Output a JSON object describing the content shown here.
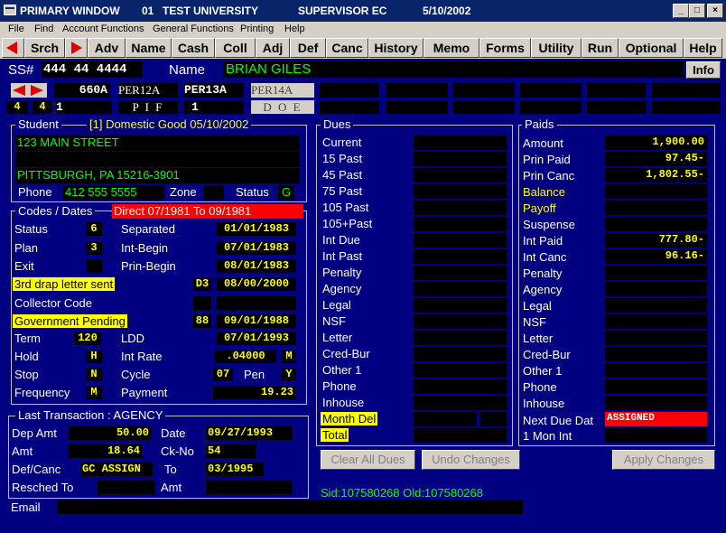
{
  "title_bar": {
    "window": "PRIMARY WINDOW",
    "code": "01",
    "institution": "TEST UNIVERSITY",
    "role": "SUPERVISOR  EC",
    "date": "5/10/2002",
    "minimize": "_",
    "maximize": "□",
    "close": "×"
  },
  "menu": [
    "File",
    "Find",
    "Account Functions",
    "General Functions",
    "Printing",
    "Help"
  ],
  "toolbar": [
    "Srch",
    "Adv",
    "Name",
    "Cash",
    "Coll",
    "Adj",
    "Def",
    "Canc",
    "History",
    "Memo",
    "Forms",
    "Utility",
    "Run",
    "Optional",
    "Help"
  ],
  "ssn_row": {
    "ss_label": "SS#",
    "ss_value": "444 44 4444",
    "name_label": "Name",
    "name_value": "BRIAN GILES",
    "info_button": "Info"
  },
  "period_row": {
    "top": [
      "660A",
      "PER12A",
      "PER13A",
      "PER14A"
    ],
    "bottom": [
      "P I F",
      "1",
      "D O E"
    ],
    "small": [
      "4",
      "4"
    ],
    "one": "1"
  },
  "student": {
    "header": "Student",
    "status_header": "[1] Domestic Good  05/10/2002",
    "address1": "123 MAIN STREET",
    "address2": "",
    "address3": "",
    "city": "PITTSBURGH, PA 15216-3901",
    "phone_label": "Phone",
    "phone": "412 555 5555",
    "zone_label": "Zone",
    "zone": "",
    "status_label": "Status",
    "status": "G"
  },
  "codes": {
    "header": "Codes / Dates",
    "direct": "Direct 07/1981 To 09/1981",
    "status_label": "Status",
    "status": "6",
    "separated_label": "Separated",
    "separated": "01/01/1983",
    "plan_label": "Plan",
    "plan": "3",
    "int_begin_label": "Int-Begin",
    "int_begin": "07/01/1983",
    "exit_label": "Exit",
    "exit": "",
    "prin_begin_label": "Prin-Begin",
    "prin_begin": "08/01/1983",
    "drap_label": "3rd drap letter sent",
    "drap_code": "D3",
    "drap_date": "08/00/2000",
    "collector_label": "Collector Code",
    "collector_code": "",
    "collector_date": "",
    "gov_label": "Government Pending",
    "gov_code": "88",
    "gov_date": "09/01/1988",
    "term_label": "Term",
    "term": "120",
    "ldd_label": "LDD",
    "ldd": "07/01/1993",
    "hold_label": "Hold",
    "hold": "H",
    "int_rate_label": "Int Rate",
    "int_rate": ".04000",
    "int_rate_code": "M",
    "stop_label": "Stop",
    "stop": "N",
    "cycle_label": "Cycle",
    "cycle": "07",
    "pen_label": "Pen",
    "pen": "Y",
    "frequency_label": "Frequency",
    "frequency": "M",
    "payment_label": "Payment",
    "payment": "19.23"
  },
  "last_transaction": {
    "header": "Last Transaction :   AGENCY",
    "dep_amt_label": "Dep Amt",
    "dep_amt": "50.00",
    "date_label": "Date",
    "date": "09/27/1993",
    "amt_label": "Amt",
    "amt": "18.64",
    "ck_no_label": "Ck-No",
    "ck_no": "54",
    "def_canc_label": "Def/Canc",
    "def_canc": "GC ASSIGN",
    "to_label": "To",
    "to": "03/1995",
    "resched_label": "Resched To",
    "resched": "",
    "amt2_label": "Amt",
    "amt2": ""
  },
  "email": {
    "label": "Email",
    "value": ""
  },
  "dues": {
    "header": "Dues",
    "rows": [
      "Current",
      "15 Past",
      "45 Past",
      "75 Past",
      "105 Past",
      "105+Past",
      "Int Due",
      "Int Past",
      "Penalty",
      "Agency",
      "Legal",
      "NSF",
      "Letter",
      "Cred-Bur",
      "Other 1",
      "Phone",
      "Inhouse"
    ],
    "month_del": "Month Del",
    "total": "Total"
  },
  "paids": {
    "header": "Paids",
    "rows": [
      {
        "label": "Amount",
        "value": "1,900.00"
      },
      {
        "label": "Prin Paid",
        "value": "97.45-"
      },
      {
        "label": "Prin Canc",
        "value": "1,802.55-"
      },
      {
        "label": "Balance",
        "value": "",
        "highlight": true
      },
      {
        "label": "Payoff",
        "value": "",
        "highlight": true
      },
      {
        "label": "Suspense",
        "value": ""
      },
      {
        "label": "Int Paid",
        "value": "777.80-"
      },
      {
        "label": "Int Canc",
        "value": "96.16-"
      },
      {
        "label": "Penalty",
        "value": ""
      },
      {
        "label": "Agency",
        "value": ""
      },
      {
        "label": "Legal",
        "value": ""
      },
      {
        "label": "NSF",
        "value": ""
      },
      {
        "label": "Letter",
        "value": ""
      },
      {
        "label": "Cred-Bur",
        "value": ""
      },
      {
        "label": "Other 1",
        "value": ""
      },
      {
        "label": "Phone",
        "value": ""
      },
      {
        "label": "Inhouse",
        "value": ""
      }
    ],
    "next_due_label": "Next Due Dat",
    "next_due": "ASSIGNED",
    "one_mon_label": "1 Mon Int",
    "one_mon": ""
  },
  "actions": {
    "clear_all_dues": "Clear All Dues",
    "undo_changes": "Undo Changes",
    "apply_changes": "Apply Changes"
  },
  "ids": "Sid:107580268  Old:107580268",
  "colors": {
    "bg": "#000080",
    "field": "#000000",
    "value": "#ffff00",
    "green": "#00ff00",
    "highlight": "#ffff00",
    "alert": "#ff0000"
  }
}
